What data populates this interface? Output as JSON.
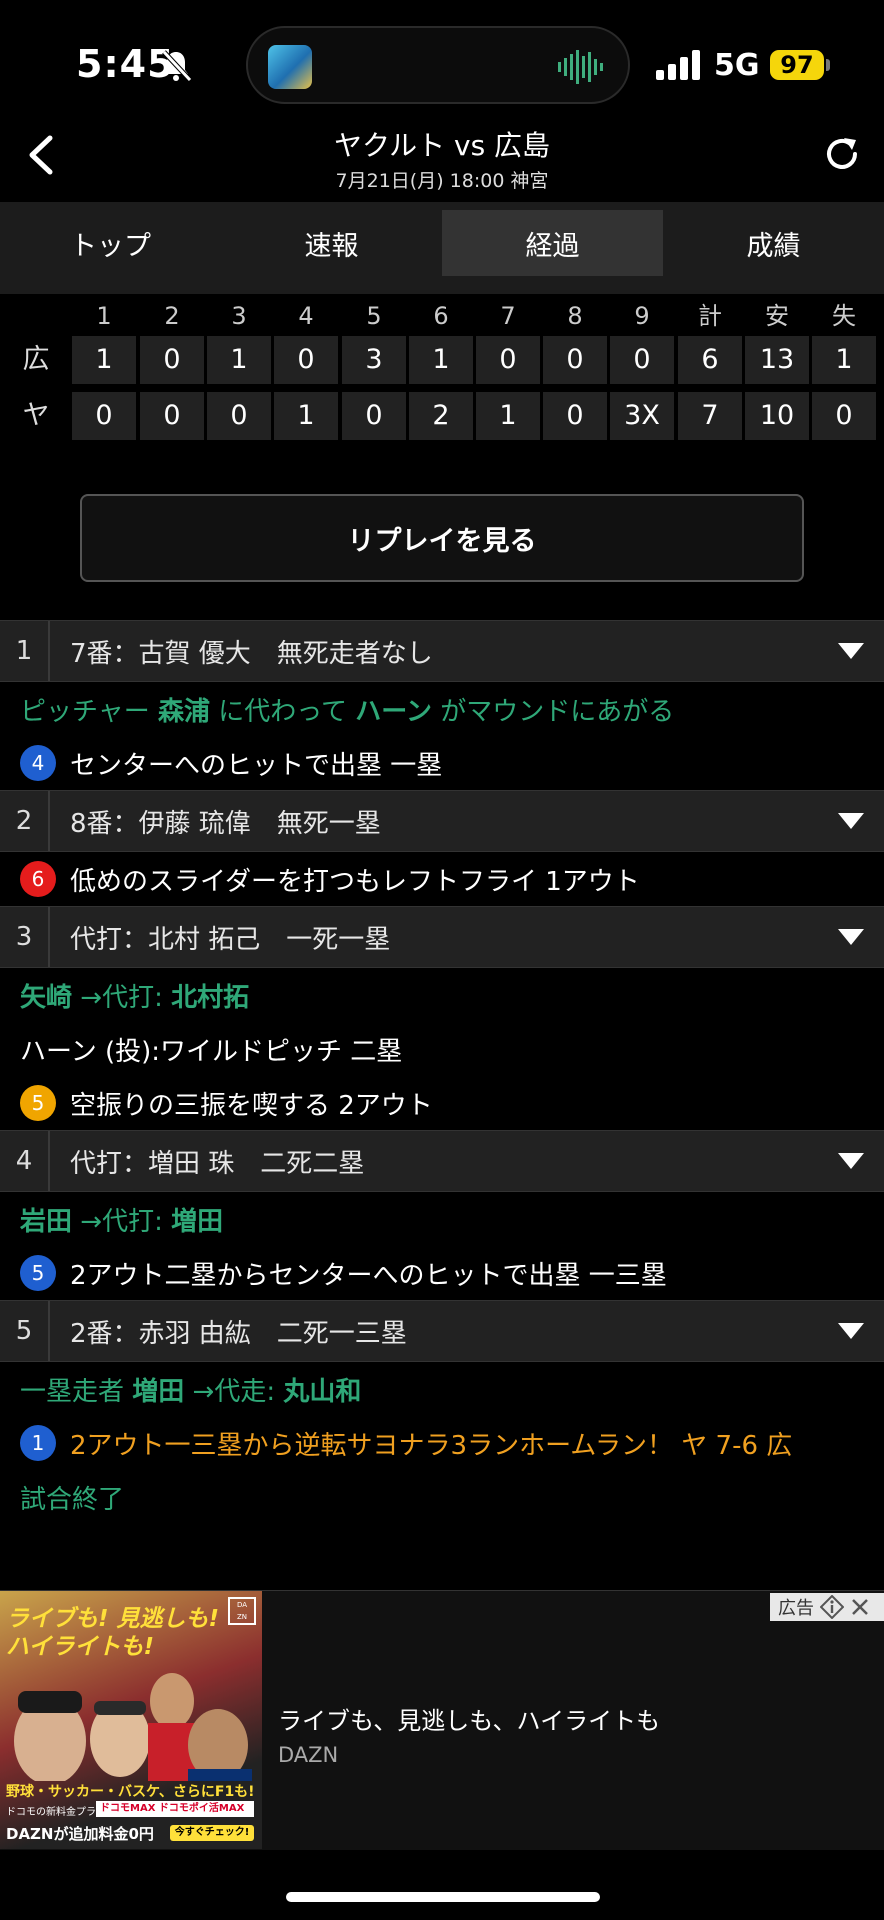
{
  "status_bar": {
    "time": "5:45",
    "network": "5G",
    "battery": "97"
  },
  "header": {
    "title": "ヤクルト vs 広島",
    "subtitle": "7月21日(月) 18:00 神宮"
  },
  "tabs": [
    {
      "label": "トップ",
      "active": false
    },
    {
      "label": "速報",
      "active": false
    },
    {
      "label": "経過",
      "active": true
    },
    {
      "label": "成績",
      "active": false
    }
  ],
  "scoreboard": {
    "columns": [
      "1",
      "2",
      "3",
      "4",
      "5",
      "6",
      "7",
      "8",
      "9",
      "計",
      "安",
      "失"
    ],
    "rows": [
      {
        "team": "広",
        "cells": [
          "1",
          "0",
          "1",
          "0",
          "3",
          "1",
          "0",
          "0",
          "0",
          "6",
          "13",
          "1"
        ]
      },
      {
        "team": "ヤ",
        "cells": [
          "0",
          "0",
          "0",
          "1",
          "0",
          "2",
          "1",
          "0",
          "3X",
          "7",
          "10",
          "0"
        ]
      }
    ]
  },
  "replay_button": "リプレイを見る",
  "pbp": [
    {
      "num": "1",
      "batter": "7番：古賀 優大　無死走者なし",
      "events": [
        {
          "type": "green",
          "parts": [
            [
              "ピッチャー ",
              false
            ],
            [
              "森浦",
              true
            ],
            [
              " に代わって ",
              false
            ],
            [
              "ハーン",
              true
            ],
            [
              " がマウンドにあがる",
              false
            ]
          ]
        },
        {
          "type": "white",
          "badge": "4",
          "badge_color": "blue",
          "text": "センターへのヒットで出塁 一塁"
        }
      ]
    },
    {
      "num": "2",
      "batter": "8番：伊藤 琉偉　無死一塁",
      "events": [
        {
          "type": "white",
          "badge": "6",
          "badge_color": "red",
          "text": "低めのスライダーを打つもレフトフライ 1アウト"
        }
      ]
    },
    {
      "num": "3",
      "batter": "代打：北村 拓己　一死一塁",
      "events": [
        {
          "type": "green",
          "parts": [
            [
              "矢崎",
              true
            ],
            [
              " →代打: ",
              false
            ],
            [
              "北村拓",
              true
            ]
          ]
        },
        {
          "type": "white",
          "text": "ハーン (投):ワイルドピッチ 二塁"
        },
        {
          "type": "white",
          "badge": "5",
          "badge_color": "yellow",
          "text": "空振りの三振を喫する 2アウト"
        }
      ]
    },
    {
      "num": "4",
      "batter": "代打：増田 珠　二死二塁",
      "events": [
        {
          "type": "green",
          "parts": [
            [
              "岩田",
              true
            ],
            [
              " →代打: ",
              false
            ],
            [
              "増田",
              true
            ]
          ]
        },
        {
          "type": "white",
          "badge": "5",
          "badge_color": "blue",
          "text": "2アウト二塁からセンターへのヒットで出塁 一三塁"
        }
      ]
    },
    {
      "num": "5",
      "batter": "2番：赤羽 由紘　二死一三塁",
      "events": [
        {
          "type": "green",
          "parts": [
            [
              "一塁走者 ",
              false
            ],
            [
              "増田",
              true
            ],
            [
              " →代走: ",
              false
            ],
            [
              "丸山和",
              true
            ]
          ]
        },
        {
          "type": "orange",
          "badge": "1",
          "badge_color": "blue",
          "text": "2アウト一三塁から逆転サヨナラ3ランホームラン！ ヤ 7-6 広"
        },
        {
          "type": "green",
          "text": "試合終了"
        }
      ]
    }
  ],
  "ad": {
    "label": "広告",
    "image_line1": "ライブも! 見逃しも!",
    "image_line2": "ハイライトも!",
    "image_logo": "DAZN",
    "image_line3": "野球・サッカー・バスケ、さらにF1も!",
    "image_line4": "ドコモの新料金プラン",
    "image_max": "ドコモMAX ドコモポイ活MAX",
    "image_line5": "DAZNが追加料金0円",
    "image_check": "今すぐチェック!",
    "title": "ライブも、見逃しも、ハイライトも",
    "brand": "DAZN"
  },
  "colors": {
    "green": "#2fa878",
    "orange": "#f0a020",
    "badge_blue": "#1f5fd0",
    "badge_red": "#e51c1c",
    "badge_yellow": "#f0a500"
  }
}
